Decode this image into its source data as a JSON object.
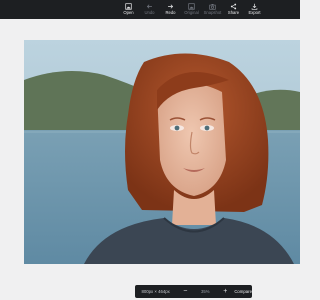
{
  "toolbar": {
    "items": [
      {
        "label": "Open",
        "icon": "image-icon",
        "enabled": true
      },
      {
        "label": "Undo",
        "icon": "arrow-left-icon",
        "enabled": false
      },
      {
        "label": "Redo",
        "icon": "arrow-right-icon",
        "enabled": true
      },
      {
        "label": "Original",
        "icon": "image-icon",
        "enabled": false
      },
      {
        "label": "Snapshot",
        "icon": "camera-icon",
        "enabled": false
      },
      {
        "label": "Share",
        "icon": "share-icon",
        "enabled": true
      },
      {
        "label": "Export",
        "icon": "download-icon",
        "enabled": true
      }
    ]
  },
  "colors": {
    "topbar": "#1d1f22",
    "canvas": "#f0f0f1",
    "bottombar": "#1d1f22"
  },
  "photo": {
    "subject": "portrait of a red-haired woman by a lake"
  },
  "bottom": {
    "dimensions": "800px × 464px",
    "zoom_out": "−",
    "zoom_level": "35%",
    "zoom_in": "+",
    "compare": "Compare"
  }
}
